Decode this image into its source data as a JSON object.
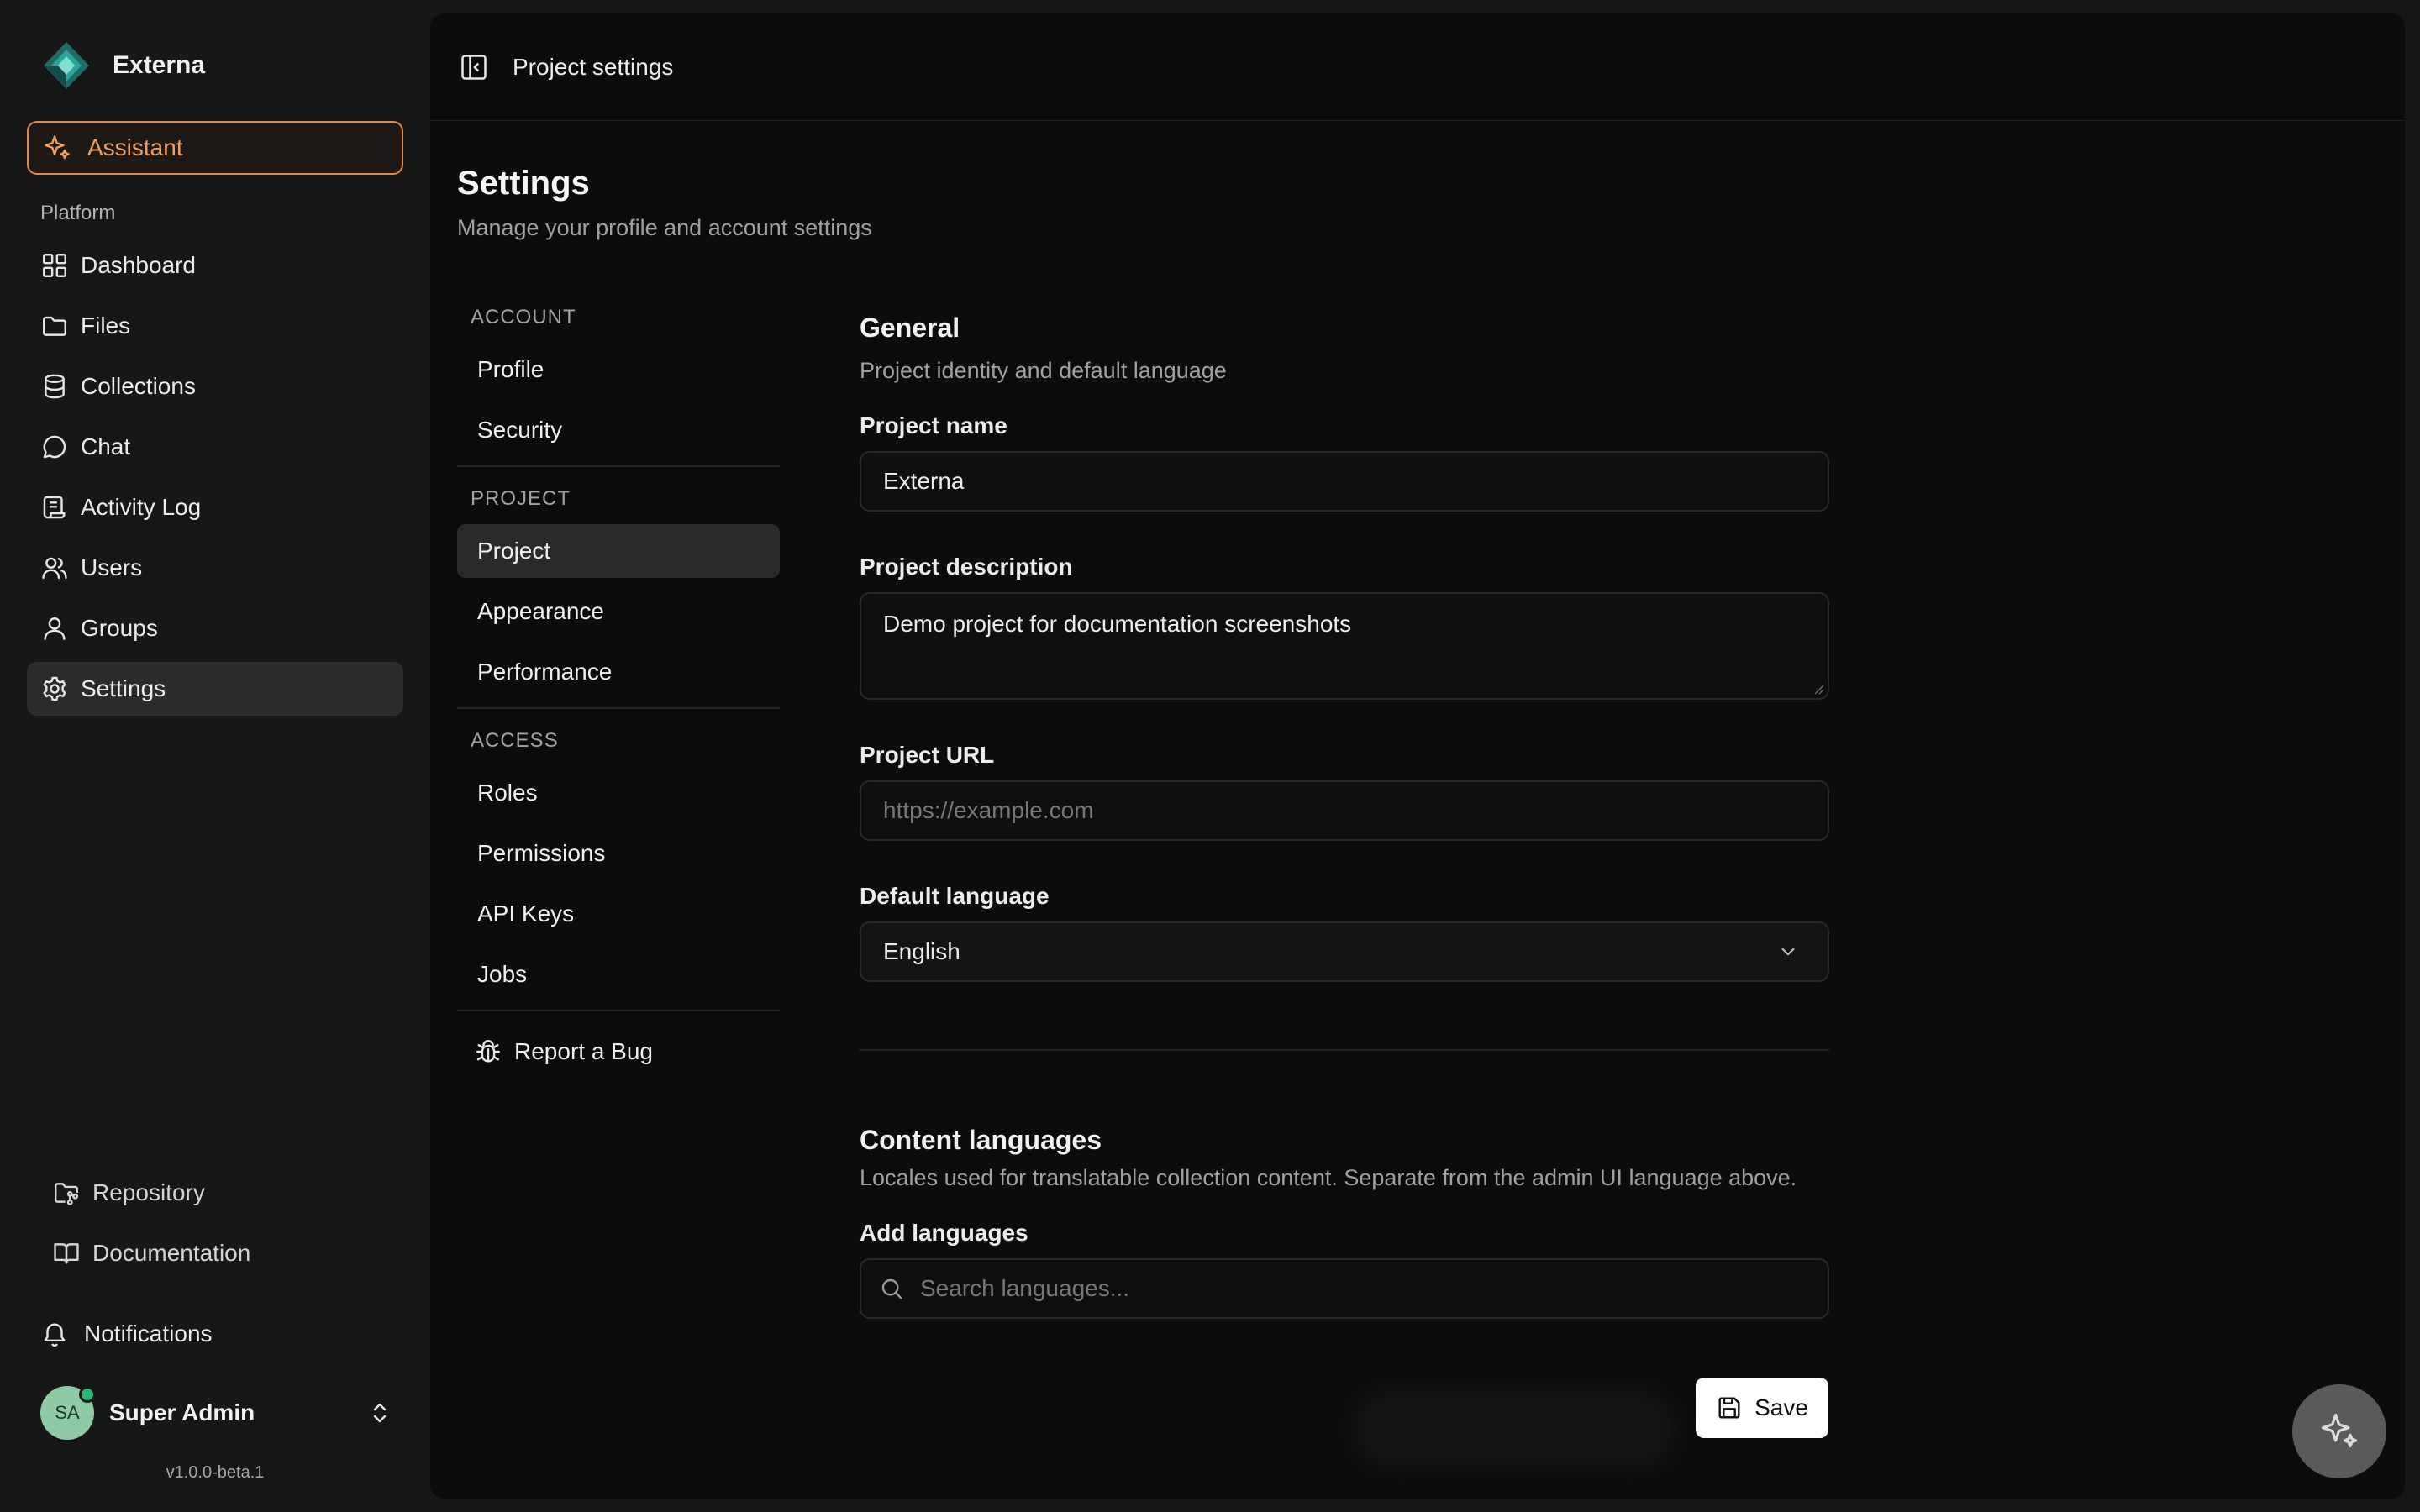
{
  "app": {
    "name": "Externa"
  },
  "sidebar": {
    "assistant_label": "Assistant",
    "section_title": "Platform",
    "items": [
      {
        "label": "Dashboard",
        "icon": "grid-icon"
      },
      {
        "label": "Files",
        "icon": "folder-icon"
      },
      {
        "label": "Collections",
        "icon": "database-icon"
      },
      {
        "label": "Chat",
        "icon": "chat-icon"
      },
      {
        "label": "Activity Log",
        "icon": "scroll-icon"
      },
      {
        "label": "Users",
        "icon": "users-icon"
      },
      {
        "label": "Groups",
        "icon": "user-icon"
      },
      {
        "label": "Settings",
        "icon": "gear-icon",
        "active": true
      }
    ],
    "bottom_items": [
      {
        "label": "Repository",
        "icon": "repository-icon"
      },
      {
        "label": "Documentation",
        "icon": "book-icon"
      }
    ],
    "notifications_label": "Notifications",
    "user": {
      "initials": "SA",
      "name": "Super Admin",
      "status": "online"
    },
    "version": "v1.0.0-beta.1"
  },
  "topbar": {
    "title": "Project settings"
  },
  "page": {
    "title": "Settings",
    "subtitle": "Manage your profile and account settings"
  },
  "settings_nav": {
    "groups": [
      {
        "heading": "ACCOUNT",
        "items": [
          {
            "label": "Profile"
          },
          {
            "label": "Security"
          }
        ]
      },
      {
        "heading": "PROJECT",
        "items": [
          {
            "label": "Project",
            "active": true
          },
          {
            "label": "Appearance"
          },
          {
            "label": "Performance"
          }
        ]
      },
      {
        "heading": "ACCESS",
        "items": [
          {
            "label": "Roles"
          },
          {
            "label": "Permissions"
          },
          {
            "label": "API Keys"
          },
          {
            "label": "Jobs"
          }
        ]
      }
    ],
    "report_bug_label": "Report a Bug"
  },
  "general": {
    "title": "General",
    "description": "Project identity and default language",
    "project_name": {
      "label": "Project name",
      "value": "Externa"
    },
    "project_description": {
      "label": "Project description",
      "value": "Demo project for documentation screenshots"
    },
    "project_url": {
      "label": "Project URL",
      "value": "",
      "placeholder": "https://example.com"
    },
    "default_language": {
      "label": "Default language",
      "value": "English"
    }
  },
  "content_languages": {
    "title": "Content languages",
    "description": "Locales used for translatable collection content. Separate from the admin UI language above.",
    "add_label": "Add languages",
    "search_placeholder": "Search languages..."
  },
  "actions": {
    "save_label": "Save"
  },
  "colors": {
    "accent": "#e08a4a",
    "avatar": "#8fcaa6",
    "online": "#2bb673"
  }
}
